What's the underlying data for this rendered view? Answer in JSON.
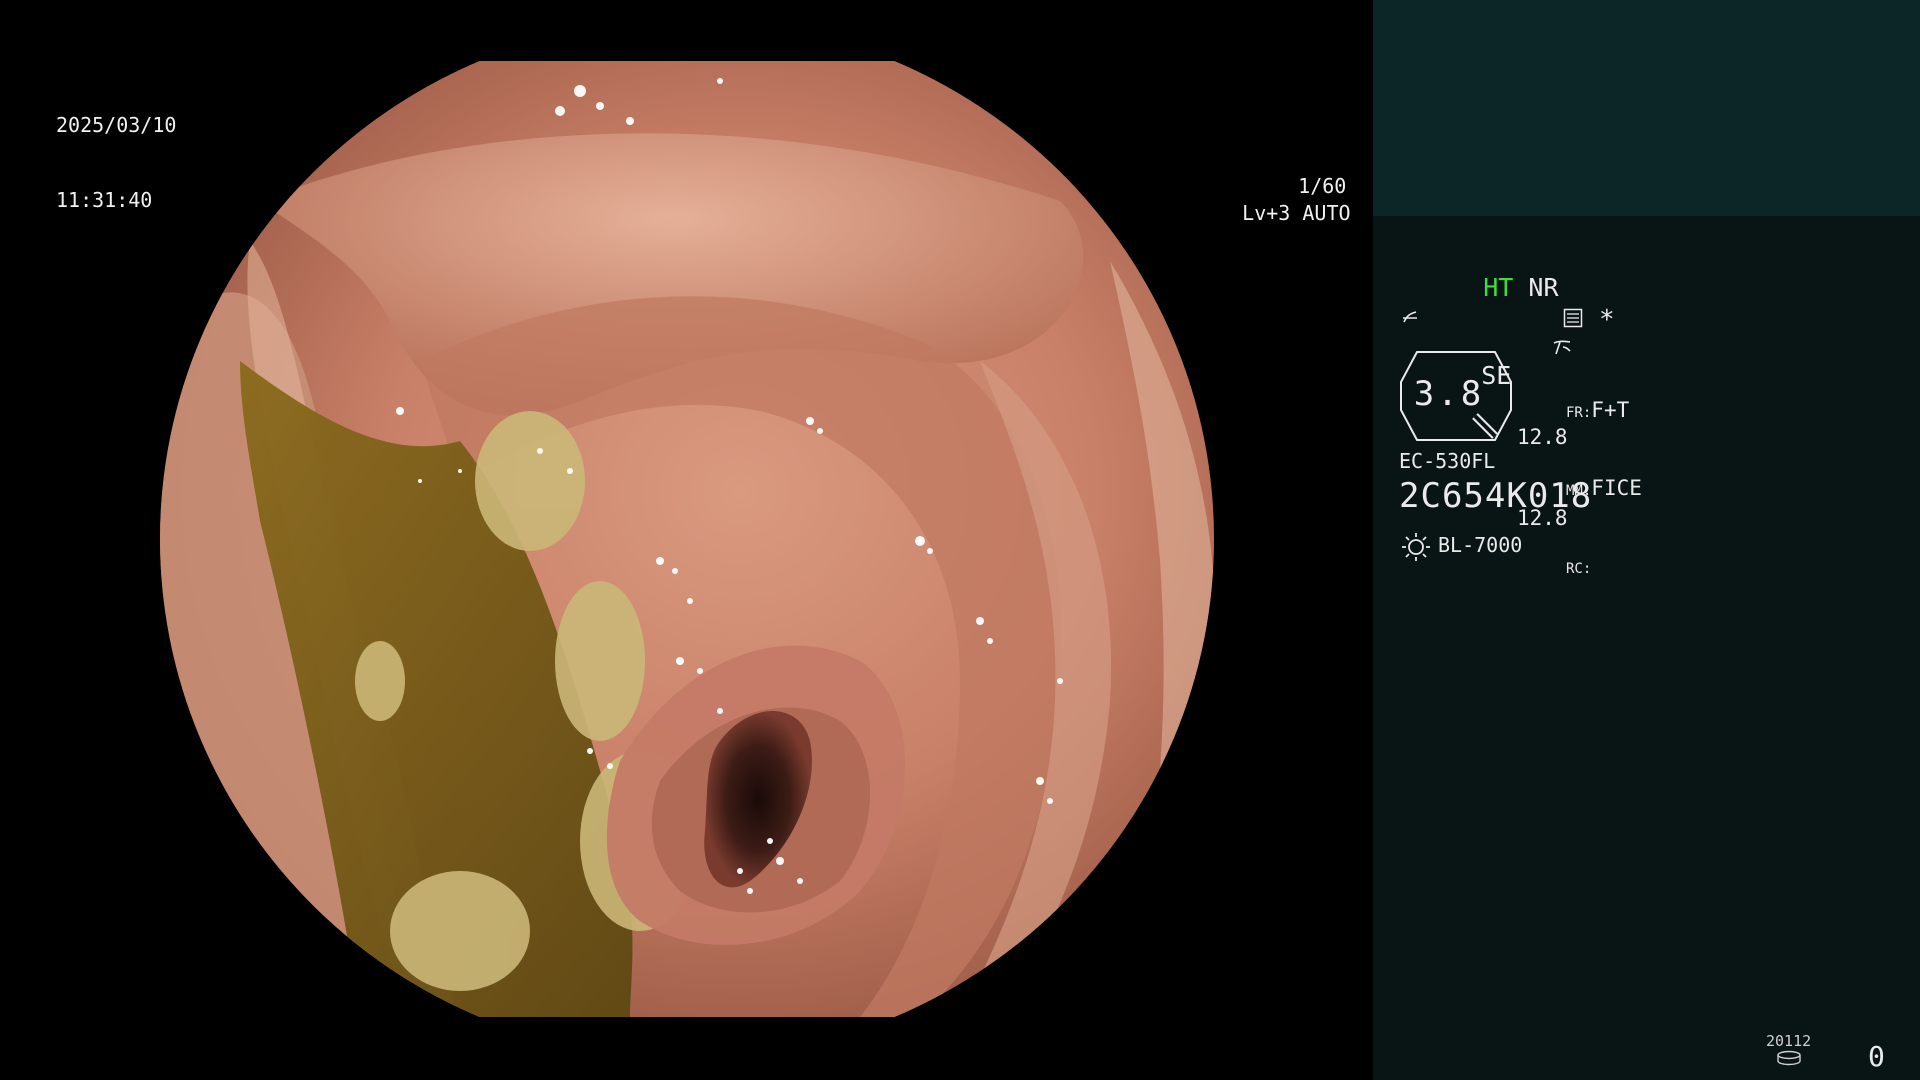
{
  "overlay": {
    "date": "2025/03/10",
    "time": "11:31:40",
    "shutter": "1/60",
    "level": "Lv+3",
    "exposure_mode": "AUTO"
  },
  "sidebar": {
    "enhance_label": "HT",
    "noise_label": "NR",
    "se_label": "SE",
    "color_label": "*",
    "zoom_value": "3.8",
    "left_values": [
      "12.8",
      "12.8"
    ],
    "fr_key": "FR:",
    "fr_value": "F+T",
    "mm_key": "MM:",
    "mm_value": "FICE",
    "rc_key": "RC:",
    "scope_model": "EC-530FL",
    "scope_serial": "2C654K018",
    "light_source": "BL-7000",
    "counter_code": "20112",
    "counter_value": "0"
  },
  "colors": {
    "accent_green": "#3fdc3f",
    "panel_top": "#0c2526",
    "panel_bottom": "#091514"
  }
}
